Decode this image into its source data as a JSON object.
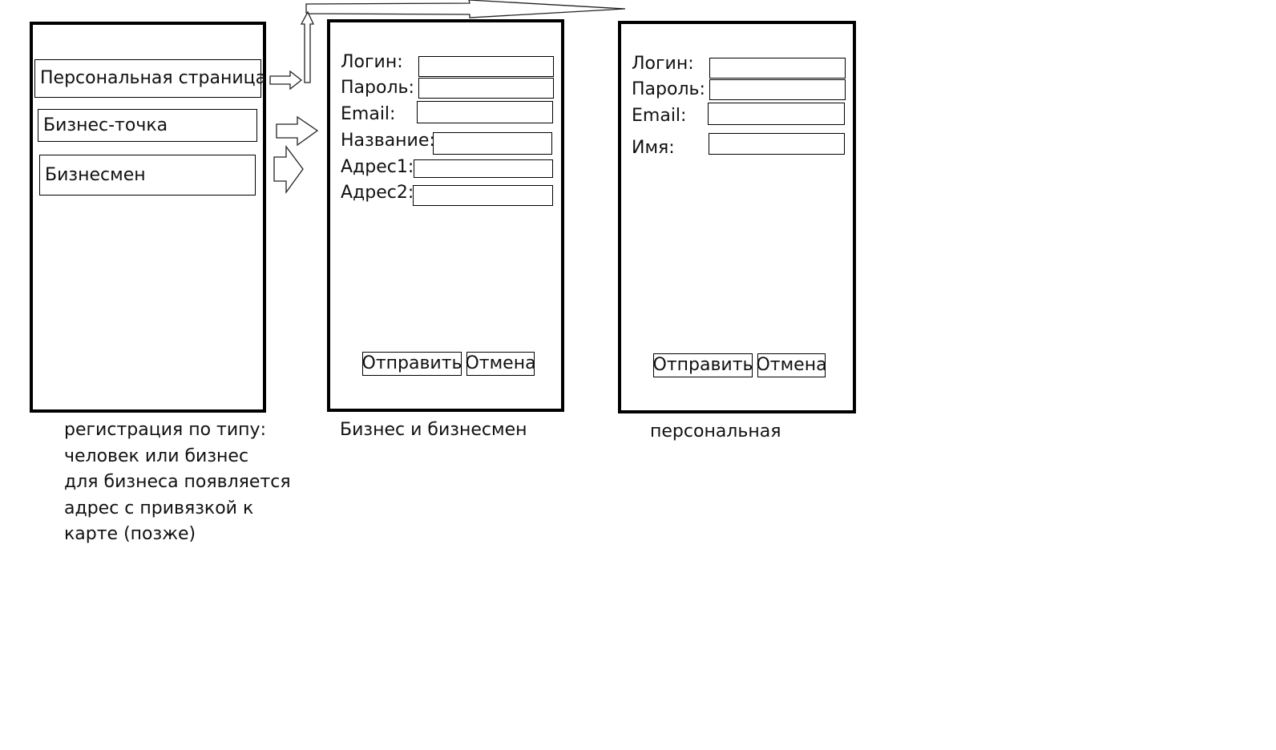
{
  "type_screen": {
    "options": [
      {
        "label": "Персональная страница"
      },
      {
        "label": "Бизнес-точка"
      },
      {
        "label": "Бизнесмен"
      }
    ],
    "caption_lines": [
      "регистрация по типу:",
      "человек или бизнес",
      "для бизнеса появляется",
      "адрес с привязкой к",
      "карте (позже)"
    ]
  },
  "business_form": {
    "fields": [
      {
        "label": "Логин:",
        "value": ""
      },
      {
        "label": "Пароль:",
        "value": ""
      },
      {
        "label": "Email:",
        "value": ""
      },
      {
        "label": "Название:",
        "value": ""
      },
      {
        "label": "Адрес1:",
        "value": ""
      },
      {
        "label": "Адрес2:",
        "value": ""
      }
    ],
    "submit_label": "Отправить",
    "cancel_label": "Отмена",
    "caption": "Бизнес и бизнесмен"
  },
  "personal_form": {
    "fields": [
      {
        "label": "Логин:",
        "value": ""
      },
      {
        "label": "Пароль:",
        "value": ""
      },
      {
        "label": "Email:",
        "value": ""
      },
      {
        "label": "Имя:",
        "value": ""
      }
    ],
    "submit_label": "Отправить",
    "cancel_label": "Отмена",
    "caption": "персональная"
  }
}
